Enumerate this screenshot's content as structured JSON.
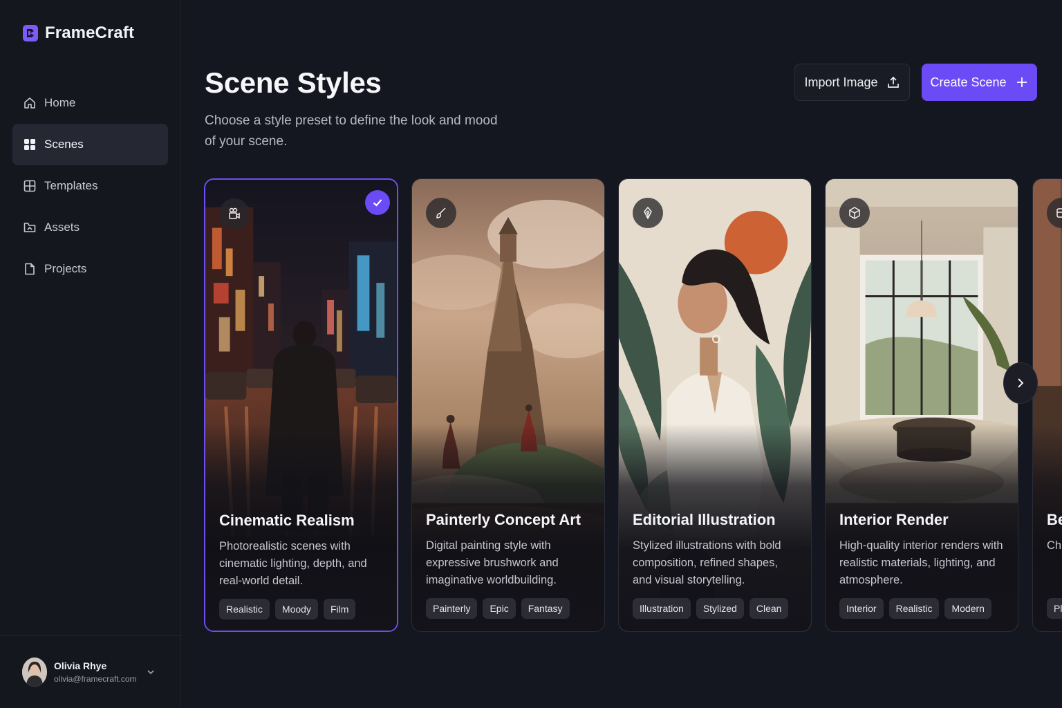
{
  "brand": {
    "name": "FrameCraft"
  },
  "sidebar": {
    "items": [
      {
        "label": "Home",
        "icon": "home-icon",
        "active": false
      },
      {
        "label": "Scenes",
        "icon": "grid-icon",
        "active": true
      },
      {
        "label": "Templates",
        "icon": "template-icon",
        "active": false
      },
      {
        "label": "Assets",
        "icon": "folder-icon",
        "active": false
      },
      {
        "label": "Projects",
        "icon": "file-icon",
        "active": false
      }
    ]
  },
  "user": {
    "name": "Olivia Rhye",
    "email": "olivia@framecraft.com"
  },
  "header": {
    "title": "Scene Styles",
    "subtitle": "Choose a style preset to define the look and mood of your scene.",
    "import_label": "Import Image",
    "create_label": "Create Scene"
  },
  "cards": [
    {
      "title": "Cinematic Realism",
      "description": "Photorealistic scenes with cinematic lighting, depth, and real-world detail.",
      "icon": "video-camera-icon",
      "selected": true,
      "tags": [
        "Realistic",
        "Moody",
        "Film"
      ]
    },
    {
      "title": "Painterly Concept Art",
      "description": "Digital painting style with expressive brushwork and imaginative worldbuilding.",
      "icon": "brush-icon",
      "selected": false,
      "tags": [
        "Painterly",
        "Epic",
        "Fantasy"
      ]
    },
    {
      "title": "Editorial Illustration",
      "description": "Stylized illustrations with bold composition, refined shapes, and visual storytelling.",
      "icon": "pen-nib-icon",
      "selected": false,
      "tags": [
        "Illustration",
        "Stylized",
        "Clean"
      ]
    },
    {
      "title": "Interior Render",
      "description": "High-quality interior renders with realistic materials, lighting, and atmosphere.",
      "icon": "cube-icon",
      "selected": false,
      "tags": [
        "Interior",
        "Realistic",
        "Modern"
      ]
    },
    {
      "title": "Be",
      "description": "Chu cou and",
      "icon": "box-icon",
      "selected": false,
      "tags": [
        "Pl"
      ]
    }
  ],
  "colors": {
    "accent": "#6b4bf6",
    "background": "#141620",
    "sidebar": "#15171f"
  }
}
